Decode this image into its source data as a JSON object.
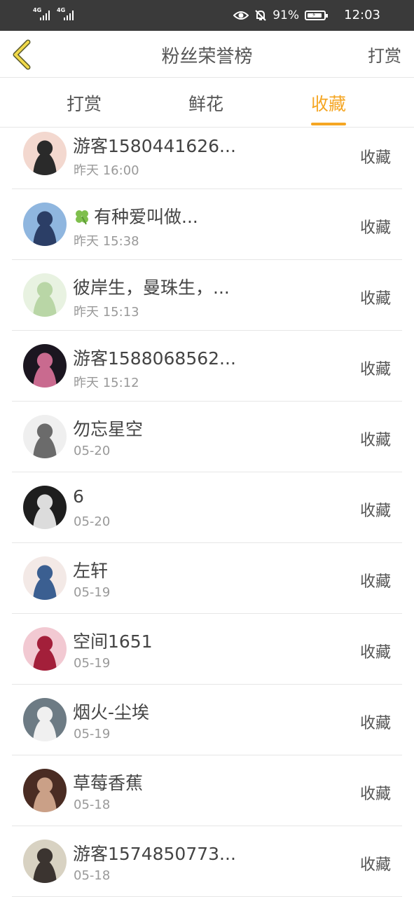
{
  "status_bar": {
    "signal1": "4G",
    "signal2": "4G",
    "battery_percent": "91%",
    "time": "12:03"
  },
  "header": {
    "title": "粉丝荣誉榜",
    "action": "打赏"
  },
  "tabs": [
    {
      "label": "打赏",
      "active": false
    },
    {
      "label": "鲜花",
      "active": false
    },
    {
      "label": "收藏",
      "active": true
    }
  ],
  "list": [
    {
      "name": "游客1580441626...",
      "time": "昨天 16:00",
      "action": "收藏",
      "avatar_colors": [
        "#f3d8cf",
        "#2a2a2a"
      ]
    },
    {
      "name": "有种爱叫做...",
      "time": "昨天 15:38",
      "action": "收藏",
      "avatar_colors": [
        "#8fb6df",
        "#2b3e66"
      ],
      "prefix_icon": "clover-icon"
    },
    {
      "name": "彼岸生，曼珠生，...",
      "time": "昨天 15:13",
      "action": "收藏",
      "avatar_colors": [
        "#e8f2e1",
        "#b9d6a6"
      ]
    },
    {
      "name": "游客1588068562...",
      "time": "昨天 15:12",
      "action": "收藏",
      "avatar_colors": [
        "#1b1620",
        "#c96a8f"
      ]
    },
    {
      "name": "勿忘星空",
      "time": "05-20",
      "action": "收藏",
      "avatar_colors": [
        "#efefef",
        "#6b6b6b"
      ]
    },
    {
      "name": "6",
      "time": "05-20",
      "action": "收藏",
      "avatar_colors": [
        "#1e1e1e",
        "#dcdcdc"
      ]
    },
    {
      "name": "左轩",
      "time": "05-19",
      "action": "收藏",
      "avatar_colors": [
        "#f3e9e6",
        "#3b5f91"
      ]
    },
    {
      "name": "空间1651",
      "time": "05-19",
      "action": "收藏",
      "avatar_colors": [
        "#f2c9d2",
        "#a31f3a"
      ]
    },
    {
      "name": "烟火-尘埃",
      "time": "05-19",
      "action": "收藏",
      "avatar_colors": [
        "#6d7b84",
        "#f0f0f0"
      ]
    },
    {
      "name": "草莓香蕉",
      "time": "05-18",
      "action": "收藏",
      "avatar_colors": [
        "#4a2c23",
        "#caa087"
      ]
    },
    {
      "name": "游客1574850773...",
      "time": "05-18",
      "action": "收藏",
      "avatar_colors": [
        "#d8d2c2",
        "#3b3430"
      ]
    }
  ]
}
